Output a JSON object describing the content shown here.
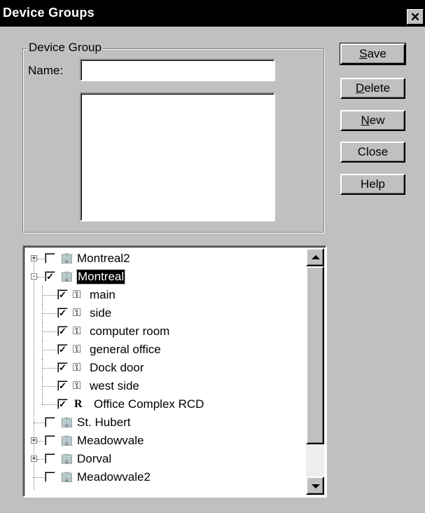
{
  "window": {
    "title": "Device Groups",
    "close_glyph": "✕"
  },
  "group": {
    "legend": "Device Group",
    "name_label": "Name:",
    "name_value": "",
    "description_value": ""
  },
  "buttons": [
    {
      "id": "save",
      "mnemonic": "S",
      "rest": "ave"
    },
    {
      "id": "delete",
      "mnemonic": "D",
      "rest": "elete"
    },
    {
      "id": "new",
      "mnemonic": "N",
      "rest": "ew"
    },
    {
      "id": "close",
      "label": "Close"
    },
    {
      "id": "help",
      "label": "Help"
    }
  ],
  "tree": {
    "items": [
      {
        "label": "Montreal2",
        "level": 0,
        "expander": "+",
        "checked": false,
        "icon": "building-icon",
        "selected": false
      },
      {
        "label": "Montreal",
        "level": 0,
        "expander": "-",
        "checked": true,
        "icon": "building-icon",
        "selected": true
      },
      {
        "label": "main",
        "level": 1,
        "checked": true,
        "icon": "key-icon"
      },
      {
        "label": "side",
        "level": 1,
        "checked": true,
        "icon": "key-icon"
      },
      {
        "label": "computer room",
        "level": 1,
        "checked": true,
        "icon": "key-icon"
      },
      {
        "label": "general office",
        "level": 1,
        "checked": true,
        "icon": "key-icon"
      },
      {
        "label": "Dock door",
        "level": 1,
        "checked": true,
        "icon": "key-icon"
      },
      {
        "label": "west side",
        "level": 1,
        "checked": true,
        "icon": "key-icon"
      },
      {
        "label": "Office Complex RCD",
        "level": 1,
        "checked": true,
        "icon": "rcd-icon"
      },
      {
        "label": "St. Hubert",
        "level": 0,
        "expander": "",
        "checked": false,
        "icon": "building-icon"
      },
      {
        "label": "Meadowvale",
        "level": 0,
        "expander": "+",
        "checked": false,
        "icon": "building-icon"
      },
      {
        "label": "Dorval",
        "level": 0,
        "expander": "+",
        "checked": false,
        "icon": "building-icon"
      },
      {
        "label": "Meadowvale2",
        "level": 0,
        "expander": "",
        "checked": false,
        "icon": "building-icon"
      }
    ]
  }
}
